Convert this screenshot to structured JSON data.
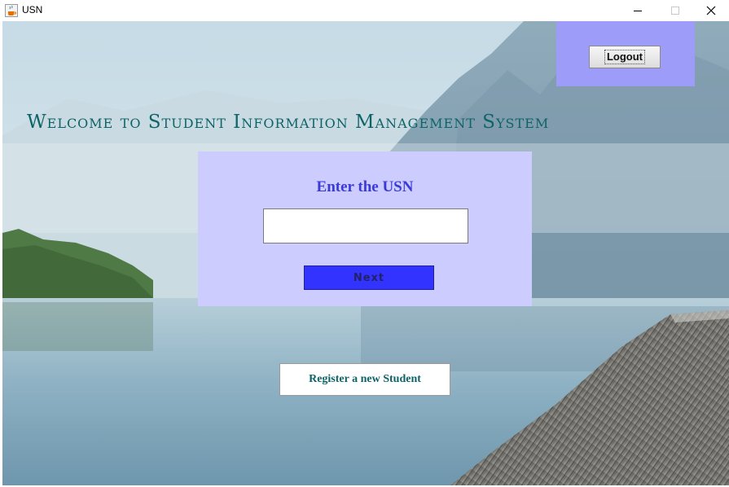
{
  "window": {
    "title": "USN",
    "icon": "java-coffee-cup-icon",
    "controls": [
      "minimize-icon",
      "maximize-icon",
      "close-icon"
    ]
  },
  "header": {
    "welcome_text": "Welcome to Student Information Management System"
  },
  "logout": {
    "label": "Logout"
  },
  "usn_form": {
    "label": "Enter the USN",
    "input_value": "",
    "next_label": "Next"
  },
  "register": {
    "label": "Register a new Student"
  },
  "colors": {
    "logout_panel": "#9d9cf9",
    "usn_panel": "#ccccff",
    "heading_teal": "#0d6467",
    "label_blue": "#3a3ad9",
    "next_button": "#3333ff"
  }
}
